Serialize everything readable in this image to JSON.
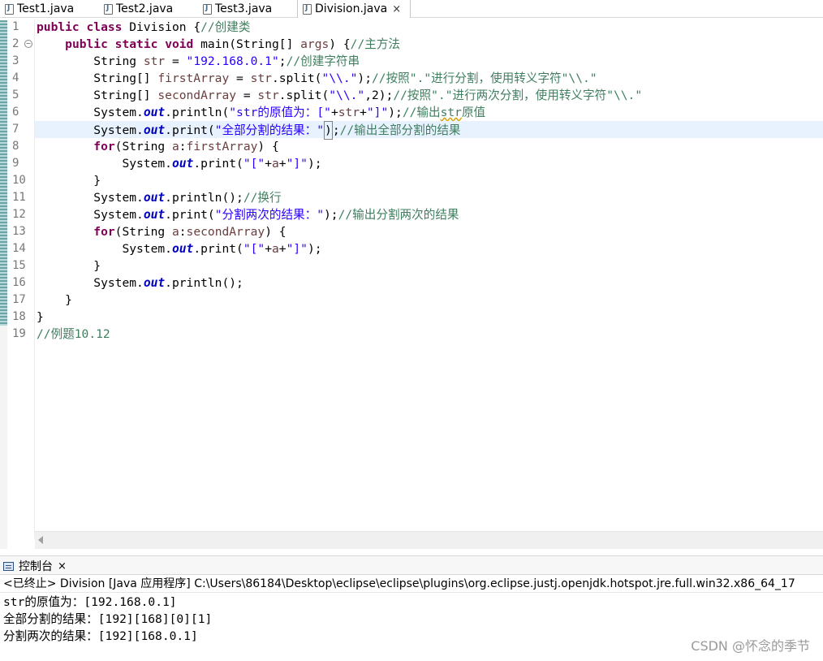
{
  "tabs": [
    {
      "label": "Test1.java",
      "active": false
    },
    {
      "label": "Test2.java",
      "active": false
    },
    {
      "label": "Test3.java",
      "active": false
    },
    {
      "label": "Division.java",
      "active": true,
      "close": "×"
    }
  ],
  "editor": {
    "line_numbers": [
      "1",
      "2",
      "3",
      "4",
      "5",
      "6",
      "7",
      "8",
      "9",
      "10",
      "11",
      "12",
      "13",
      "14",
      "15",
      "16",
      "17",
      "18",
      "19"
    ],
    "fold_marker": "−",
    "current_line": 7,
    "code": {
      "l1": {
        "kw1": "public",
        "kw2": "class",
        "name": " Division {",
        "cmt": "//创建类"
      },
      "l2": {
        "kw1": "public",
        "kw2": "static",
        "kw3": "void",
        "sig": " main(String[] ",
        "arg": "args",
        "rest": ") {",
        "cmt": "//主方法"
      },
      "l3": {
        "type": "String ",
        "var": "str",
        "eq": " = ",
        "str": "\"192.168.0.1\"",
        "semi": ";",
        "cmt": "//创建字符串"
      },
      "l4": {
        "type": "String[] ",
        "var": "firstArray",
        "eq": " = ",
        "obj": "str",
        "call": ".split(",
        "str": "\"\\\\.\"",
        "end": ");",
        "cmt": "//按照\".\"进行分割，使用转义字符\"\\\\.\""
      },
      "l5": {
        "type": "String[] ",
        "var": "secondArray",
        "eq": " = ",
        "obj": "str",
        "call": ".split(",
        "str": "\"\\\\.\"",
        "end": ",2);",
        "cmt": "//按照\".\"进行两次分割，使用转义字符\"\\\\.\""
      },
      "l6": {
        "sys": "System.",
        "fld": "out",
        "call": ".println(",
        "str1": "\"str的原值为：[\"",
        "plus1": "+",
        "var": "str",
        "plus2": "+",
        "str2": "\"]\"",
        "end": ");",
        "cmt1": "//输出",
        "cmt2": "str",
        "cmt3": "原值"
      },
      "l7": {
        "sys": "System.",
        "fld": "out",
        "call": ".print(",
        "str": "\"全部分割的结果：\"",
        "caret": ")",
        "end": ";",
        "cmt": "//输出全部分割的结果"
      },
      "l8": {
        "kw": "for",
        "open": "(String ",
        "var": "a",
        "colon": ":",
        "arr": "firstArray",
        "close": ") {"
      },
      "l9": {
        "sys": "System.",
        "fld": "out",
        "call": ".print(",
        "str1": "\"[\"",
        "plus1": "+",
        "var": "a",
        "plus2": "+",
        "str2": "\"]\"",
        "end": ");"
      },
      "l10": {
        "text": "}"
      },
      "l11": {
        "sys": "System.",
        "fld": "out",
        "call": ".println();",
        "cmt": "//换行"
      },
      "l12": {
        "sys": "System.",
        "fld": "out",
        "call": ".print(",
        "str": "\"分割两次的结果：\"",
        "end": ");",
        "cmt": "//输出分割两次的结果"
      },
      "l13": {
        "kw": "for",
        "open": "(String ",
        "var": "a",
        "colon": ":",
        "arr": "secondArray",
        "close": ") {"
      },
      "l14": {
        "sys": "System.",
        "fld": "out",
        "call": ".print(",
        "str1": "\"[\"",
        "plus1": "+",
        "var": "a",
        "plus2": "+",
        "str2": "\"]\"",
        "end": ");"
      },
      "l15": {
        "text": "}"
      },
      "l16": {
        "sys": "System.",
        "fld": "out",
        "call": ".println();"
      },
      "l17": {
        "text": "}"
      },
      "l18": {
        "text": "}"
      },
      "l19": {
        "cmt": "//例题10.12"
      }
    }
  },
  "console": {
    "tab_label": "控制台",
    "tab_close": "×",
    "header": "<已终止> Division [Java 应用程序] C:\\Users\\86184\\Desktop\\eclipse\\eclipse\\plugins\\org.eclipse.justj.openjdk.hotspot.jre.full.win32.x86_64_17",
    "output": [
      "str的原值为：[192.168.0.1]",
      "全部分割的结果：[192][168][0][1]",
      "分割两次的结果：[192][168.0.1]"
    ]
  },
  "watermark": "CSDN @怀念的季节"
}
